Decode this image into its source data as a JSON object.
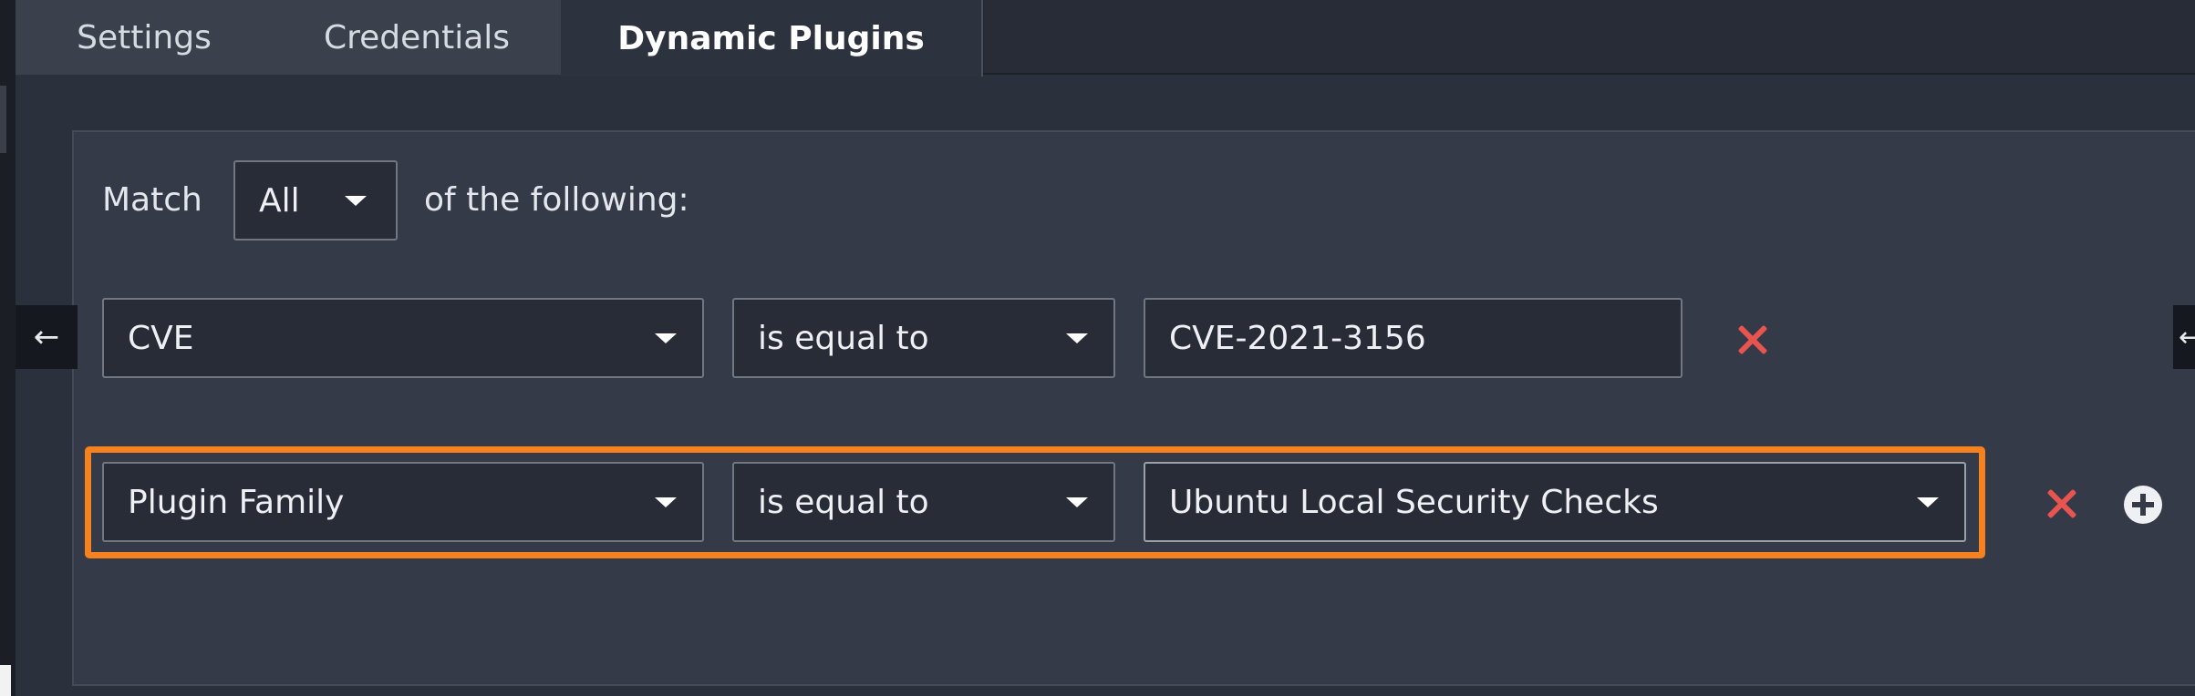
{
  "tabs": {
    "settings": "Settings",
    "credentials": "Credentials",
    "dynamic_plugins": "Dynamic Plugins",
    "active": "Dynamic Plugins"
  },
  "match": {
    "prefix": "Match",
    "value": "All",
    "suffix": "of the following:"
  },
  "rules": [
    {
      "field": "CVE",
      "operator": "is equal to",
      "value": "CVE-2021-3156",
      "value_type": "text-input"
    },
    {
      "field": "Plugin Family",
      "operator": "is equal to",
      "value": "Ubuntu Local Security Checks",
      "value_type": "select",
      "highlighted": true
    }
  ],
  "icons": {
    "nav_back": "arrow-left-icon",
    "nav_forward": "arrow-right-icon",
    "remove": "close-icon",
    "add": "plus-circle-icon",
    "dropdown": "caret-down-icon"
  },
  "colors": {
    "highlight": "#f5821f",
    "remove": "#e8544f",
    "panel_bg": "#343a47",
    "active_tab_bg": "#2d333e"
  }
}
